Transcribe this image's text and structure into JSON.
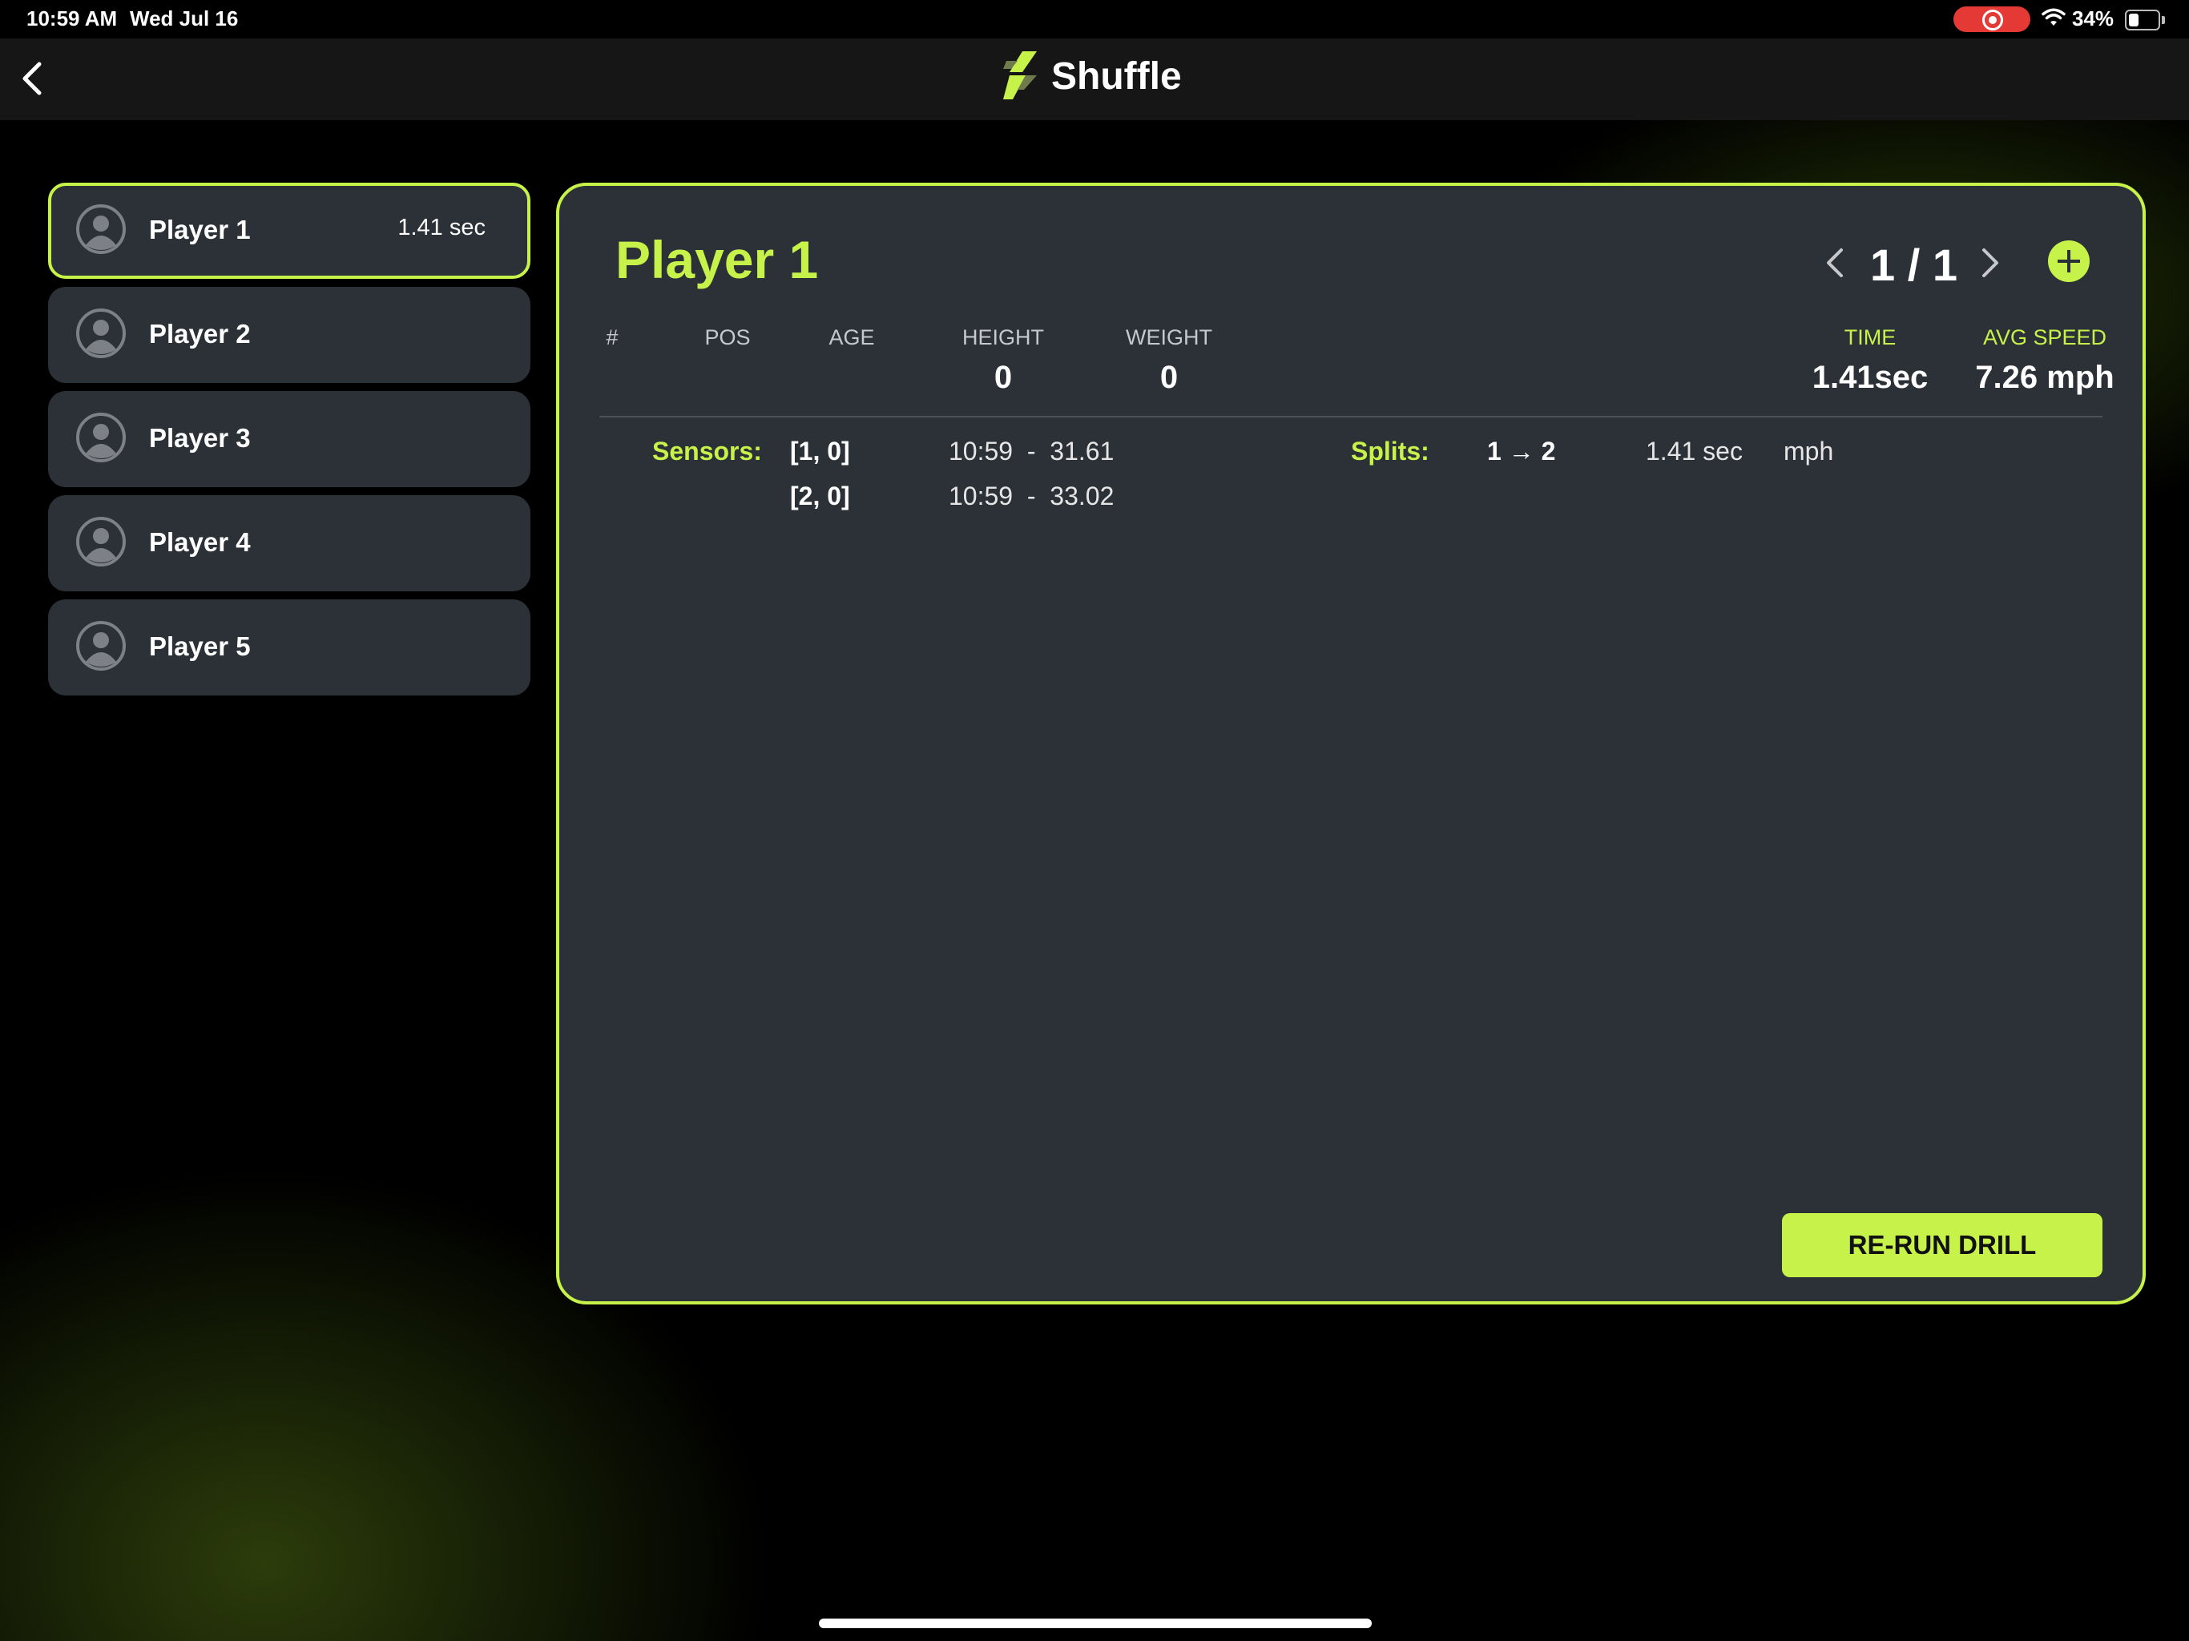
{
  "status_bar": {
    "time": "10:59 AM",
    "date": "Wed Jul 16",
    "battery_percent": "34%",
    "battery_level": 0.34,
    "recording": true
  },
  "nav": {
    "title": "Shuffle",
    "back_icon": "chevron-left-icon",
    "logo_icon": "bolt-logo-icon"
  },
  "players": [
    {
      "name": "Player 1",
      "time": "1.41 sec",
      "active": true
    },
    {
      "name": "Player 2",
      "time": "",
      "active": false
    },
    {
      "name": "Player 3",
      "time": "",
      "active": false
    },
    {
      "name": "Player 4",
      "time": "",
      "active": false
    },
    {
      "name": "Player 5",
      "time": "",
      "active": false
    }
  ],
  "detail": {
    "title": "Player 1",
    "pager": "1 / 1",
    "stats": {
      "number": {
        "label": "#",
        "value": ""
      },
      "pos": {
        "label": "POS",
        "value": ""
      },
      "age": {
        "label": "AGE",
        "value": ""
      },
      "height": {
        "label": "HEIGHT",
        "value": "0"
      },
      "weight": {
        "label": "WEIGHT",
        "value": "0"
      },
      "time": {
        "label": "TIME",
        "value": "1.41sec"
      },
      "avg_speed": {
        "label": "AVG SPEED",
        "value": "7.26 mph"
      }
    },
    "sensors_label": "Sensors:",
    "sensors": [
      {
        "id": "[1, 0]",
        "time": "10:59  -  31.61"
      },
      {
        "id": "[2, 0]",
        "time": "10:59  -  33.02"
      }
    ],
    "splits_label": "Splits:",
    "splits": [
      {
        "range": "1 → 2",
        "time": "1.41 sec",
        "speed": "mph"
      }
    ],
    "rerun_label": "RE-RUN DRILL"
  },
  "colors": {
    "accent": "#c7f24a",
    "panel": "#2c3138",
    "background": "#000000",
    "record": "#e53935"
  }
}
